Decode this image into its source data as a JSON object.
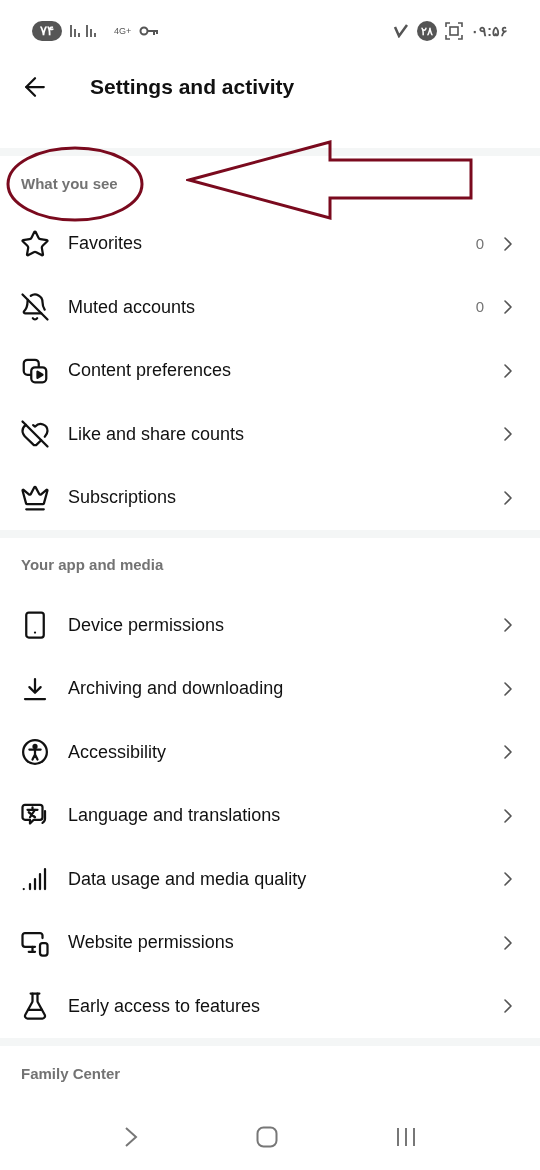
{
  "status_bar": {
    "battery": "۷۴",
    "network": "4G+",
    "notification_count": "۲۸",
    "time": "۰۹:۵۶"
  },
  "header": {
    "title": "Settings and activity"
  },
  "sections": [
    {
      "title": "What you see",
      "annotated": true,
      "items": [
        {
          "kind": "star",
          "label": "Favorites",
          "count": "0"
        },
        {
          "kind": "bell-off",
          "label": "Muted accounts",
          "count": "0"
        },
        {
          "kind": "media",
          "label": "Content preferences"
        },
        {
          "kind": "heart-off",
          "label": "Like and share counts"
        },
        {
          "kind": "crown",
          "label": "Subscriptions"
        }
      ]
    },
    {
      "title": "Your app and media",
      "annotated": false,
      "items": [
        {
          "kind": "phone",
          "label": "Device permissions"
        },
        {
          "kind": "download",
          "label": "Archiving and downloading"
        },
        {
          "kind": "accessibility",
          "label": "Accessibility"
        },
        {
          "kind": "translate",
          "label": "Language and translations"
        },
        {
          "kind": "signal",
          "label": "Data usage and media quality"
        },
        {
          "kind": "devices",
          "label": "Website permissions"
        },
        {
          "kind": "flask",
          "label": "Early access to features"
        }
      ]
    },
    {
      "title": "Family Center",
      "annotated": false
    }
  ]
}
